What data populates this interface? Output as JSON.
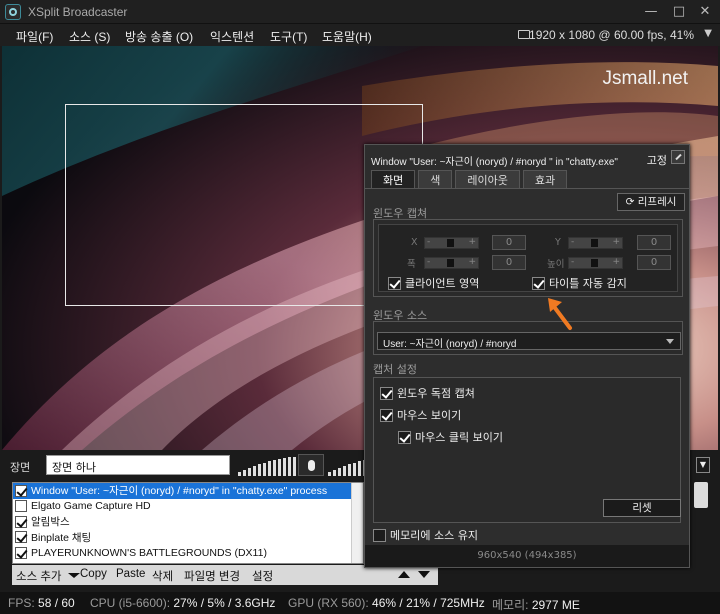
{
  "app": {
    "title": "XSplit Broadcaster"
  },
  "menu": [
    {
      "label": "파일(F)"
    },
    {
      "label": "소스 (S)"
    },
    {
      "label": "방송 송출 (O)"
    },
    {
      "label": "익스텐션"
    },
    {
      "label": "도구(T)"
    },
    {
      "label": "도움말(H)"
    }
  ],
  "resolution": "1920 x 1080 @ 60.00 fps, 41%",
  "stage": {
    "watermark": "Jsmall.net"
  },
  "scene": {
    "label": "장면",
    "value": "장면 하나"
  },
  "sources": [
    {
      "label": "Window \"User: ~자근이 (noryd) / #noryd\" in \"chatty.exe\" process",
      "checked": true,
      "selected": true
    },
    {
      "label": "Elgato Game Capture HD",
      "checked": false,
      "selected": false
    },
    {
      "label": "알림박스",
      "checked": true,
      "selected": false
    },
    {
      "label": "Binplate 채팅",
      "checked": true,
      "selected": false
    },
    {
      "label": "PLAYERUNKNOWN'S BATTLEGROUNDS (DX11)",
      "checked": true,
      "selected": false
    }
  ],
  "toolbar": {
    "add": "소스 추가",
    "copy": "Copy",
    "paste": "Paste",
    "delete": "삭제",
    "rename": "파일명 변경",
    "settings": "설정"
  },
  "status": {
    "fps_label": "FPS:",
    "fps_value": "58 / 60",
    "cpu_label": "CPU (i5-6600):",
    "cpu_value": "27% / 5% / 3.6GHz",
    "gpu_label": "GPU (RX 560):",
    "gpu_value": "46% / 21% / 725MHz",
    "mem_label": "메모리:",
    "mem_value": "2977 ME"
  },
  "dialog": {
    "title": "Window \"User: ~자근이 (noryd) / #noryd \" in \"chatty.exe\"",
    "pin_label": "고정",
    "tabs": [
      "화면",
      "색",
      "레이아웃",
      "효과"
    ],
    "window_capture_title": "윈도우 캡쳐",
    "refresh": "리프레시",
    "x_label": "X",
    "y_label": "Y",
    "width_label": "폭",
    "height_label": "높이",
    "x_value": "0",
    "y_value": "0",
    "width_value": "0",
    "height_value": "0",
    "client_area": "클라이언트 영역",
    "auto_title": "타이틀 자동 감지",
    "window_source_title": "윈도우 소스",
    "window_source_value": "User: ~자근이 (noryd) / #noryd",
    "capture_settings_title": "캡처 설정",
    "exclusive_capture": "윈도우 독점 캡쳐",
    "show_mouse": "마우스 보이기",
    "show_mouse_clicks": "마우스 클릭 보이기",
    "reset": "리셋",
    "keep_in_memory": "메모리에 소스 유지",
    "footer": "960x540 (494x385)"
  }
}
